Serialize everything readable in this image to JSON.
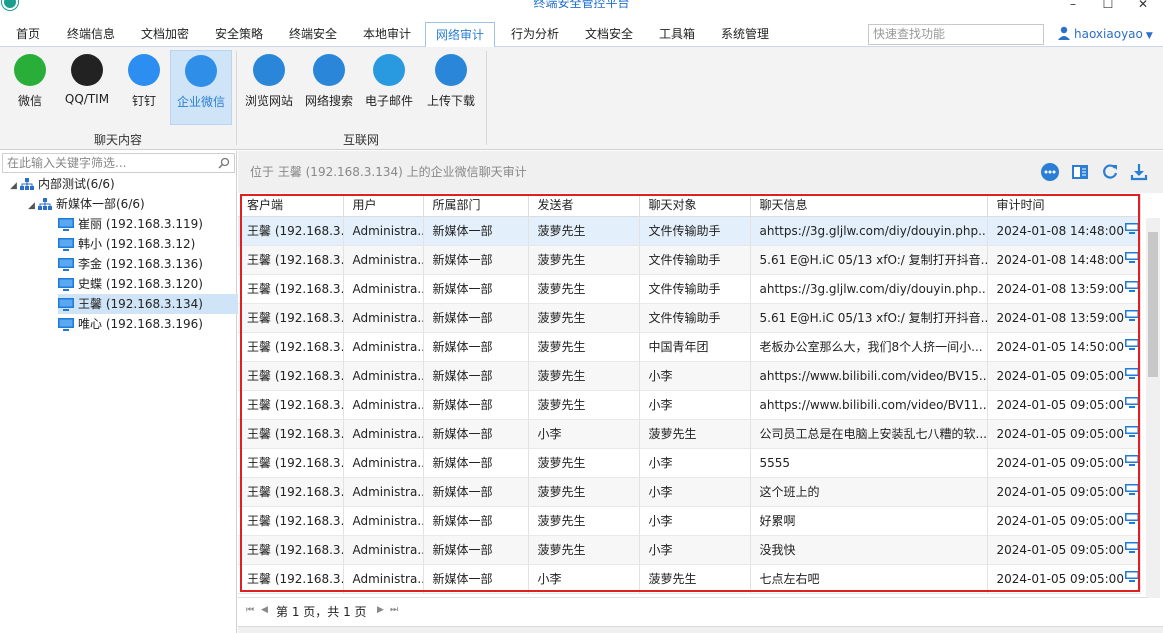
{
  "app": {
    "title": "终端安全管控平台"
  },
  "menu": {
    "tabs": [
      "首页",
      "终端信息",
      "文档加密",
      "安全策略",
      "终端安全",
      "本地审计",
      "网络审计",
      "行为分析",
      "文档安全",
      "工具箱",
      "系统管理"
    ],
    "active_index": 6,
    "search_placeholder": "快速查找功能",
    "user": "haoxiaoyao"
  },
  "ribbon": {
    "groups": [
      {
        "label": "聊天内容",
        "buttons": [
          {
            "label": "微信",
            "icon": "wechat-icon",
            "color": "#2aae3a"
          },
          {
            "label": "QQ/TIM",
            "icon": "qq-penguin-icon",
            "color": "#222222"
          },
          {
            "label": "钉钉",
            "icon": "dingtalk-icon",
            "color": "#2b8ef0"
          },
          {
            "label": "企业微信",
            "icon": "wecom-icon",
            "color": "#2f8fe8",
            "active": true
          }
        ]
      },
      {
        "label": "互联网",
        "buttons": [
          {
            "label": "浏览网站",
            "icon": "globe-icon",
            "color": "#2a86d8"
          },
          {
            "label": "网络搜索",
            "icon": "web-search-icon",
            "color": "#2a86d8"
          },
          {
            "label": "电子邮件",
            "icon": "envelope-icon",
            "color": "#2a9ae0"
          },
          {
            "label": "上传下载",
            "icon": "cloud-transfer-icon",
            "color": "#2a86d8"
          }
        ]
      }
    ]
  },
  "tree": {
    "filter_placeholder": "在此输入关键字筛选...",
    "nodes": [
      {
        "label": "内部测试(6/6)",
        "level": 0,
        "type": "org"
      },
      {
        "label": "新媒体一部(6/6)",
        "level": 1,
        "type": "org"
      },
      {
        "label": "崔丽 (192.168.3.119)",
        "level": 2,
        "type": "pc"
      },
      {
        "label": "韩小 (192.168.3.12)",
        "level": 2,
        "type": "pc"
      },
      {
        "label": "李金 (192.168.3.136)",
        "level": 2,
        "type": "pc"
      },
      {
        "label": "史蝶 (192.168.3.120)",
        "level": 2,
        "type": "pc"
      },
      {
        "label": "王馨 (192.168.3.134)",
        "level": 2,
        "type": "pc",
        "selected": true
      },
      {
        "label": "唯心  (192.168.3.196)",
        "level": 2,
        "type": "pc"
      }
    ]
  },
  "main": {
    "location_text": "位于 王馨 (192.168.3.134) 上的企业微信聊天审计",
    "columns": [
      "客户端",
      "用户",
      "所属部门",
      "发送者",
      "聊天对象",
      "聊天信息",
      "审计时间"
    ],
    "rows": [
      [
        "王馨 (192.168.3...",
        "Administra...",
        "新媒体一部",
        "菠萝先生",
        "文件传输助手",
        "ahttps://3g.gljlw.com/diy/douyin.php...",
        "2024-01-08 14:48:00"
      ],
      [
        "王馨 (192.168.3...",
        "Administra...",
        "新媒体一部",
        "菠萝先生",
        "文件传输助手",
        "5.61 E@H.iC 05/13 xfO:/ 复制打开抖音...",
        "2024-01-08 14:48:00"
      ],
      [
        "王馨 (192.168.3...",
        "Administra...",
        "新媒体一部",
        "菠萝先生",
        "文件传输助手",
        "ahttps://3g.gljlw.com/diy/douyin.php...",
        "2024-01-08 13:59:00"
      ],
      [
        "王馨 (192.168.3...",
        "Administra...",
        "新媒体一部",
        "菠萝先生",
        "文件传输助手",
        "5.61 E@H.iC 05/13 xfO:/ 复制打开抖音...",
        "2024-01-08 13:59:00"
      ],
      [
        "王馨 (192.168.3...",
        "Administra...",
        "新媒体一部",
        "菠萝先生",
        "中国青年团",
        "老板办公室那么大，我们8个人挤一间小...",
        "2024-01-05 14:50:00"
      ],
      [
        "王馨 (192.168.3...",
        "Administra...",
        "新媒体一部",
        "菠萝先生",
        "小李",
        "ahttps://www.bilibili.com/video/BV15...",
        "2024-01-05 09:05:00"
      ],
      [
        "王馨 (192.168.3...",
        "Administra...",
        "新媒体一部",
        "菠萝先生",
        "小李",
        "ahttps://www.bilibili.com/video/BV11...",
        "2024-01-05 09:05:00"
      ],
      [
        "王馨 (192.168.3...",
        "Administra...",
        "新媒体一部",
        "小李",
        "菠萝先生",
        "公司员工总是在电脑上安装乱七八糟的软...",
        "2024-01-05 09:05:00"
      ],
      [
        "王馨 (192.168.3...",
        "Administra...",
        "新媒体一部",
        "菠萝先生",
        "小李",
        "5555",
        "2024-01-05 09:05:00"
      ],
      [
        "王馨 (192.168.3...",
        "Administra...",
        "新媒体一部",
        "菠萝先生",
        "小李",
        "这个班上的",
        "2024-01-05 09:05:00"
      ],
      [
        "王馨 (192.168.3...",
        "Administra...",
        "新媒体一部",
        "菠萝先生",
        "小李",
        "好累啊",
        "2024-01-05 09:05:00"
      ],
      [
        "王馨 (192.168.3...",
        "Administra...",
        "新媒体一部",
        "菠萝先生",
        "小李",
        "没我快",
        "2024-01-05 09:05:00"
      ],
      [
        "王馨 (192.168.3...",
        "Administra...",
        "新媒体一部",
        "小李",
        "菠萝先生",
        "七点左右吧",
        "2024-01-05 09:05:00"
      ]
    ],
    "pager_text": "第 1 页，共 1 页"
  },
  "colors": {
    "accent": "#2a7fd4",
    "highlight_frame": "#e02020",
    "selected_row": "#e3effa"
  }
}
